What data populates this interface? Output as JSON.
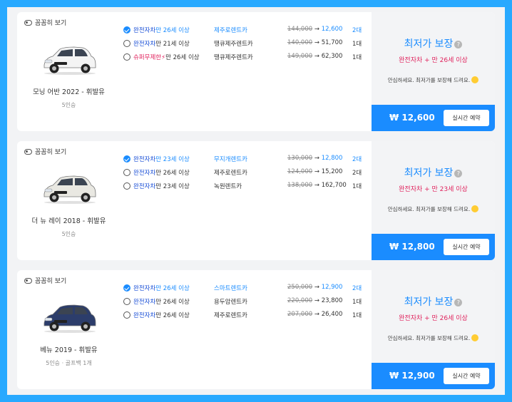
{
  "cards": [
    {
      "peek_label": "꼼꼼히 보기",
      "car_name": "모닝 어반 2022 - 휘발유",
      "car_sub": "5인승",
      "car_color": "#f4f4f4",
      "offers": [
        {
          "ins_type": "완전자차",
          "ins_prefix": "",
          "ins_age": "만 26세 이상",
          "company": "제주로렌트카",
          "old_price": "144,000",
          "price": "12,600",
          "qty": "2대",
          "selected": true,
          "super": false
        },
        {
          "ins_type": "완전자차",
          "ins_prefix": "",
          "ins_age": "만 21세 이상",
          "company": "땡큐제주렌트카",
          "old_price": "140,000",
          "price": "51,700",
          "qty": "1대",
          "selected": false,
          "super": false
        },
        {
          "ins_type": "슈퍼무제한",
          "ins_prefix": "⚡",
          "ins_age": "만 26세 이상",
          "company": "땡큐제주렌트카",
          "old_price": "149,000",
          "price": "62,300",
          "qty": "1대",
          "selected": false,
          "super": true
        }
      ],
      "guarantee": "최저가 보장",
      "condition": "완전자차 + 만 26세 이상",
      "message": "안심하세요. 최저가를 보장해 드려요.",
      "total": "₩ 12,600",
      "reserve_label": "실시간 예약"
    },
    {
      "peek_label": "꼼꼼히 보기",
      "car_name": "더 뉴 레이 2018 - 휘발유",
      "car_sub": "5인승",
      "car_color": "#e9e8e2",
      "offers": [
        {
          "ins_type": "완전자차",
          "ins_prefix": "",
          "ins_age": "만 23세 이상",
          "company": "무지개렌트카",
          "old_price": "130,000",
          "price": "12,800",
          "qty": "2대",
          "selected": true,
          "super": false
        },
        {
          "ins_type": "완전자차",
          "ins_prefix": "",
          "ins_age": "만 26세 이상",
          "company": "제주로렌트카",
          "old_price": "124,000",
          "price": "15,200",
          "qty": "2대",
          "selected": false,
          "super": false
        },
        {
          "ins_type": "완전자차",
          "ins_prefix": "",
          "ins_age": "만 23세 이상",
          "company": "녹원렌트카",
          "old_price": "138,000",
          "price": "162,700",
          "qty": "1대",
          "selected": false,
          "super": false
        }
      ],
      "guarantee": "최저가 보장",
      "condition": "완전자차 + 만 23세 이상",
      "message": "안심하세요. 최저가를 보장해 드려요.",
      "total": "₩ 12,800",
      "reserve_label": "실시간 예약"
    },
    {
      "peek_label": "꼼꼼히 보기",
      "car_name": "베뉴 2019 - 휘발유",
      "car_sub": "5인승 · 골프백 1개",
      "car_color": "#2c3d6b",
      "offers": [
        {
          "ins_type": "완전자차",
          "ins_prefix": "",
          "ins_age": "만 26세 이상",
          "company": "스마트렌트카",
          "old_price": "250,000",
          "price": "12,900",
          "qty": "2대",
          "selected": true,
          "super": false
        },
        {
          "ins_type": "완전자차",
          "ins_prefix": "",
          "ins_age": "만 26세 이상",
          "company": "용두암렌트카",
          "old_price": "220,000",
          "price": "23,800",
          "qty": "1대",
          "selected": false,
          "super": false
        },
        {
          "ins_type": "완전자차",
          "ins_prefix": "",
          "ins_age": "만 26세 이상",
          "company": "제주로렌트카",
          "old_price": "207,000",
          "price": "26,400",
          "qty": "1대",
          "selected": false,
          "super": false
        }
      ],
      "guarantee": "최저가 보장",
      "condition": "완전자차 + 만 26세 이상",
      "message": "안심하세요. 최저가를 보장해 드려요.",
      "total": "₩ 12,900",
      "reserve_label": "실시간 예약"
    }
  ],
  "arrow": "→",
  "info_glyph": "?",
  "colors": {
    "accent": "#1a8cff",
    "background": "#28a9ff",
    "condition": "#e0245e"
  }
}
